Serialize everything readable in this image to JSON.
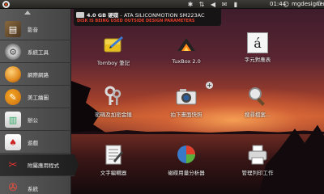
{
  "top_panel": {
    "clock": "01:44",
    "user": "mgdesigner",
    "tray_icons": [
      "bluetooth-icon",
      "network-icon",
      "volume-icon",
      "mail-icon",
      "battery-icon"
    ]
  },
  "notification": {
    "title_bold": "4.0 GB 硬碟",
    "title_rest": " - ATA SILICONMOTION SM223AC",
    "warning": "DISK IS BEING USED OUTSIDE DESIGN PARAMETERS"
  },
  "sidebar": {
    "items": [
      {
        "label": "影音",
        "icon": "media-icon"
      },
      {
        "label": "系統工具",
        "icon": "system-tools-icon"
      },
      {
        "label": "網際網路",
        "icon": "internet-icon"
      },
      {
        "label": "美工繪圖",
        "icon": "graphics-icon"
      },
      {
        "label": "辦公",
        "icon": "office-icon"
      },
      {
        "label": "遊戲",
        "icon": "games-icon"
      },
      {
        "label": "附屬應用程式",
        "icon": "accessories-icon"
      },
      {
        "label": "系統",
        "icon": "system-icon"
      }
    ],
    "selected_index": 6
  },
  "launchers": [
    {
      "label": "Tomboy 筆記",
      "icon": "notes-icon"
    },
    {
      "label": "TuxBox 2.0",
      "icon": "tuxbox-icon"
    },
    {
      "label": "字元對應表",
      "icon": "character-map-icon"
    },
    {
      "label": "密碼及加密金鑰",
      "icon": "keys-icon"
    },
    {
      "label": "拍下畫面快照",
      "icon": "camera-icon"
    },
    {
      "label": "搜尋檔案...",
      "icon": "search-icon"
    },
    {
      "label": "文字編輯器",
      "icon": "text-editor-icon"
    },
    {
      "label": "磁碟用量分析器",
      "icon": "disk-usage-icon"
    },
    {
      "label": "管理列印工作",
      "icon": "printer-icon"
    }
  ],
  "char_map_glyph": "á"
}
